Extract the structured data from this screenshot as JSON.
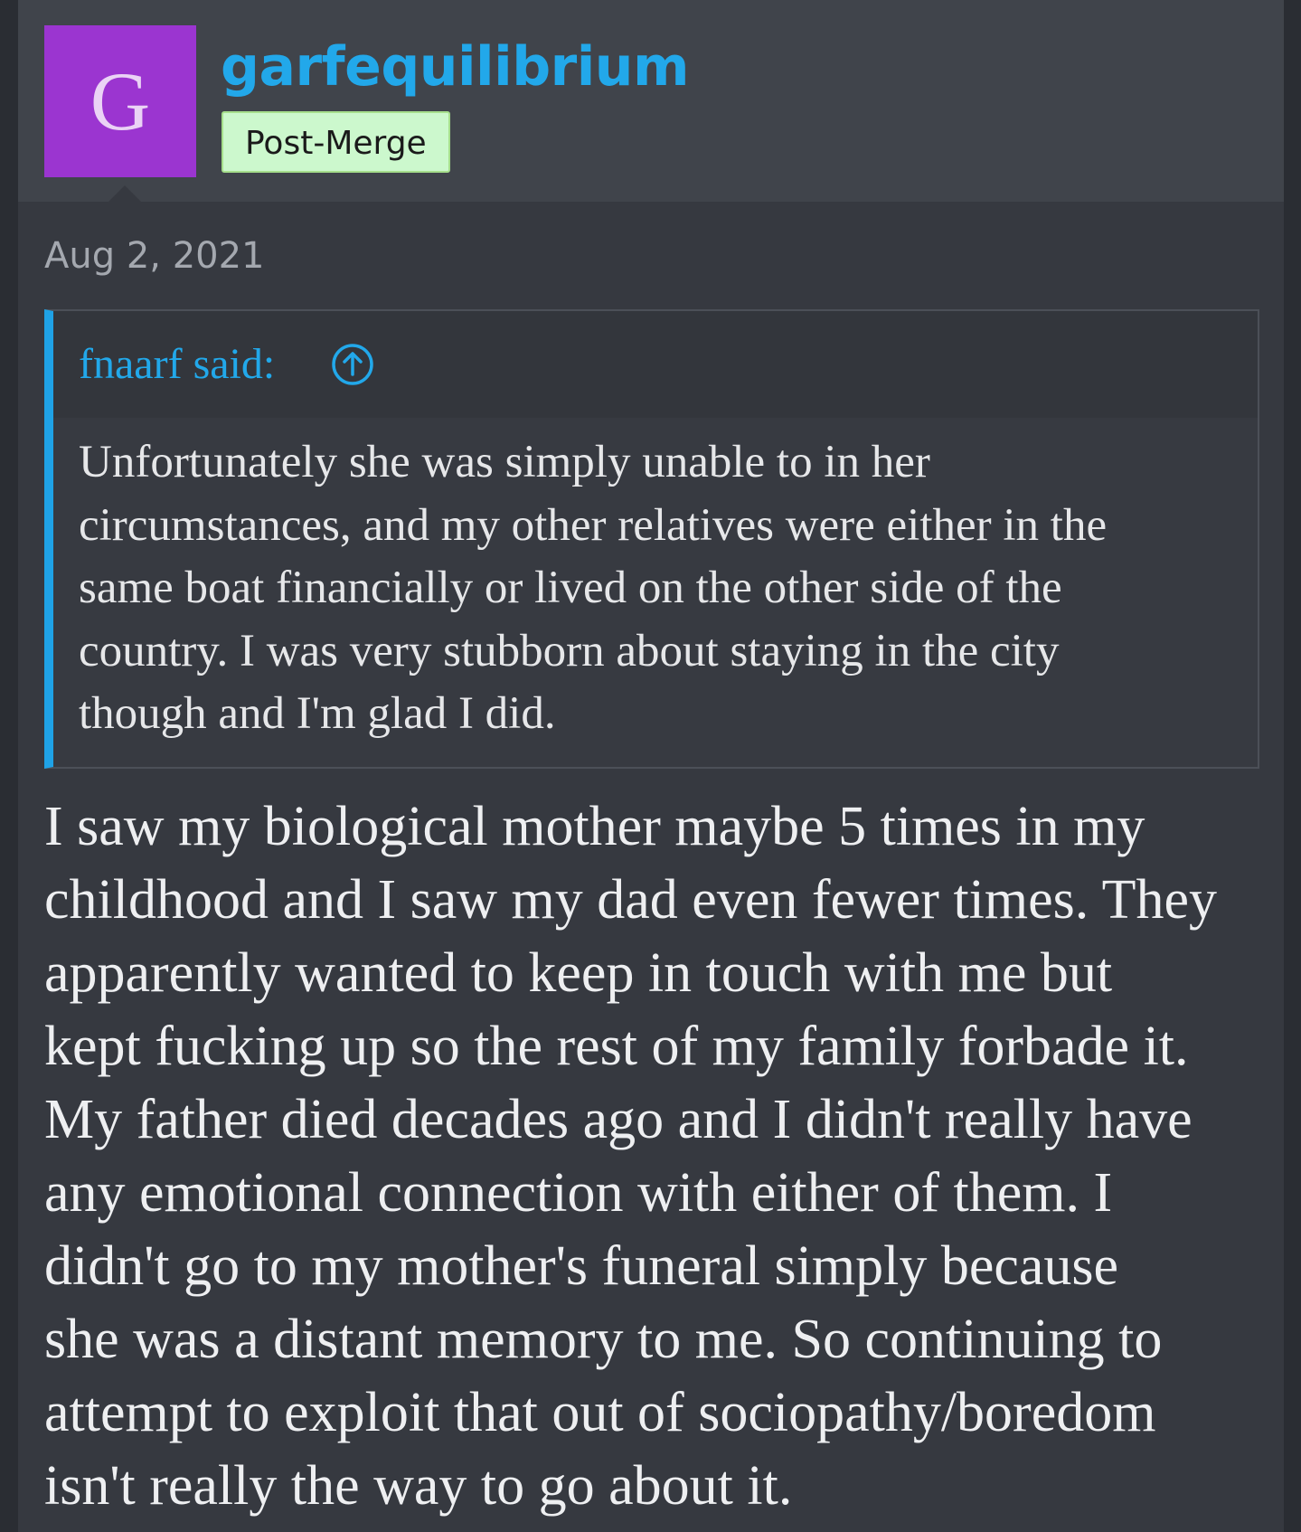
{
  "author": {
    "avatar_letter": "G",
    "username": "garfequilibrium",
    "badge": "Post-Merge"
  },
  "post": {
    "date": "Aug 2, 2021",
    "quote": {
      "author_label": "fnaarf said:",
      "jump_icon": "arrow-up-circle-icon",
      "lines": [
        "Unfortunately she was simply unable to in her",
        "circumstances, and my other relatives were either in the",
        "same boat financially or lived on the other side of the",
        "country. I was very stubborn about staying in the city",
        "though and I'm glad I did."
      ]
    },
    "body_lines": [
      "I saw my biological mother maybe 5 times in my",
      "childhood and I saw my dad even fewer times. They",
      "apparently wanted to keep in touch with me but",
      "kept fucking up so the rest of my family forbade it.",
      "My father died decades ago and I didn't really have",
      "any emotional connection with either of them. I",
      "didn't go to my mother's funeral simply because",
      "she was a distant memory to me. So continuing to",
      "attempt to exploit that out of sociopathy/boredom",
      "isn't really the way to go about it."
    ]
  },
  "colors": {
    "page_bg": "#363940",
    "header_bg": "#40444b",
    "avatar_bg": "#9b35d0",
    "accent": "#22a8ea",
    "badge_bg": "#ccf8cd",
    "quote_border": "#1fa2e6"
  }
}
